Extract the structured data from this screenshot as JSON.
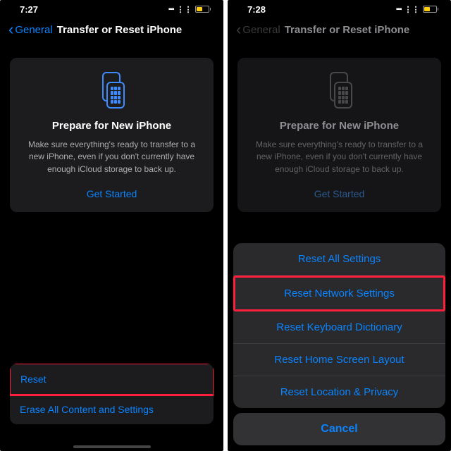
{
  "left": {
    "time": "7:27",
    "back": "General",
    "title": "Transfer or Reset iPhone",
    "card": {
      "heading": "Prepare for New iPhone",
      "body": "Make sure everything's ready to transfer to a new iPhone, even if you don't currently have enough iCloud storage to back up.",
      "cta": "Get Started"
    },
    "rows": {
      "reset": "Reset",
      "erase": "Erase All Content and Settings"
    }
  },
  "right": {
    "time": "7:28",
    "back": "General",
    "title": "Transfer or Reset iPhone",
    "card": {
      "heading": "Prepare for New iPhone",
      "body": "Make sure everything's ready to transfer to a new iPhone, even if you don't currently have enough iCloud storage to back up.",
      "cta": "Get Started"
    },
    "sheet": {
      "opt1": "Reset All Settings",
      "opt2": "Reset Network Settings",
      "opt3": "Reset Keyboard Dictionary",
      "opt4": "Reset Home Screen Layout",
      "opt5": "Reset Location & Privacy",
      "cancel": "Cancel"
    }
  }
}
